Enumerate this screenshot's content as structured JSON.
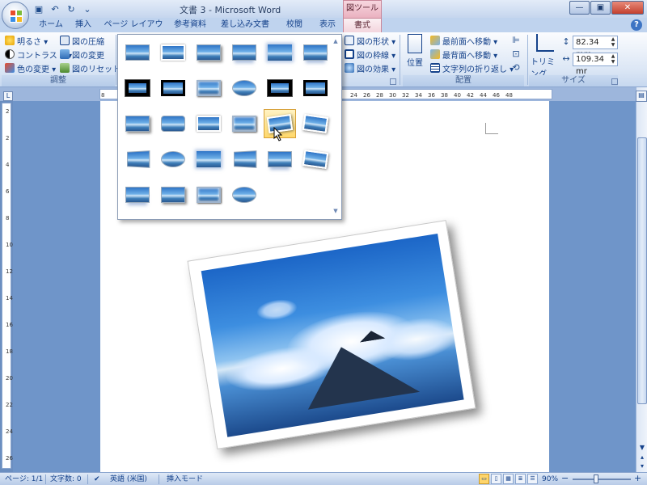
{
  "titlebar": {
    "title": "文書 3 - Microsoft Word",
    "tool_tab_title": "図ツール",
    "window_controls": {
      "minimize": "—",
      "maximize": "▣",
      "close": "✕"
    }
  },
  "qat": {
    "save_icon": "save-icon",
    "undo": "↶",
    "redo": "↻"
  },
  "tabs": [
    {
      "label": "ホーム"
    },
    {
      "label": "挿入"
    },
    {
      "label": "ページ レイアウト"
    },
    {
      "label": "参考資料"
    },
    {
      "label": "差し込み文書"
    },
    {
      "label": "校閲"
    },
    {
      "label": "表示"
    },
    {
      "label": "書式"
    }
  ],
  "ribbon": {
    "adjust": {
      "brightness": "明るさ ▾",
      "contrast": "コントラスト ▾",
      "recolor": "色の変更 ▾",
      "compress": "図の圧縮",
      "change_picture": "図の変更",
      "reset_picture": "図のリセット",
      "group_label": "調整"
    },
    "styles": {
      "shape": "図の形状 ▾",
      "border": "図の枠線 ▾",
      "effects": "図の効果 ▾"
    },
    "arrange": {
      "position": "位置",
      "bring_front": "最前面へ移動 ▾",
      "send_back": "最背面へ移動 ▾",
      "text_wrap": "文字列の折り返し ▾",
      "group_label": "配置"
    },
    "size": {
      "crop": "トリミング",
      "height": "82.34 mm",
      "width": "109.34 mr",
      "group_label": "サイズ"
    }
  },
  "ruler": {
    "top_numbers": [
      "8",
      "24",
      "26",
      "28",
      "30",
      "32",
      "34",
      "36",
      "38",
      "40",
      "42",
      "44",
      "46",
      "48"
    ],
    "left_numbers": [
      "2",
      "2",
      "4",
      "6",
      "8",
      "10",
      "12",
      "14",
      "16",
      "18",
      "20",
      "22",
      "24",
      "26"
    ]
  },
  "status": {
    "page": "ページ: 1/1",
    "words": "文字数: 0",
    "language": "英語 (米国)",
    "mode": "挿入モード",
    "zoom": "90%",
    "zoom_out": "−",
    "zoom_in": "+"
  },
  "gallery": {
    "items": [
      {
        "style": "s-plain",
        "name": "simple-frame-style"
      },
      {
        "style": "s-white",
        "name": "white-frame-style"
      },
      {
        "style": "s-shadow",
        "name": "drop-shadow-style"
      },
      {
        "style": "s-reflect",
        "name": "reflected-style"
      },
      {
        "style": "s-soft",
        "name": "soft-edge-style"
      },
      {
        "style": "s-reflect",
        "name": "reflected-rounded-style"
      },
      {
        "style": "s-thick",
        "name": "thick-black-frame-style"
      },
      {
        "style": "s-black",
        "name": "black-frame-style"
      },
      {
        "style": "s-bevel",
        "name": "beveled-style"
      },
      {
        "style": "s-oval",
        "name": "oval-style"
      },
      {
        "style": "s-thick",
        "name": "metal-frame-style"
      },
      {
        "style": "s-black",
        "name": "double-frame-style"
      },
      {
        "style": "s-shadow",
        "name": "center-shadow-style"
      },
      {
        "style": "s-round",
        "name": "rounded-diagonal-style"
      },
      {
        "style": "s-white",
        "name": "snip-corner-style"
      },
      {
        "style": "s-bevel",
        "name": "simple-white-style"
      },
      {
        "style": "s-tilt-l",
        "name": "rotated-white-style"
      },
      {
        "style": "s-tilt-r",
        "name": "perspective-shadow-style"
      },
      {
        "style": "s-persp",
        "name": "relaxed-perspective-style"
      },
      {
        "style": "s-oval",
        "name": "soft-oval-style"
      },
      {
        "style": "s-soft",
        "name": "glow-style"
      },
      {
        "style": "s-persp",
        "name": "bevel-perspective-style"
      },
      {
        "style": "s-reflect",
        "name": "reflected-bevel-style"
      },
      {
        "style": "s-tilt-r",
        "name": "tilted-frame-style"
      },
      {
        "style": "s-reflect",
        "name": "black-reflected-style"
      },
      {
        "style": "s-shadow",
        "name": "moderate-frame-style"
      },
      {
        "style": "s-bevel",
        "name": "metal-rounded-style"
      },
      {
        "style": "s-oval",
        "name": "metal-oval-style"
      }
    ],
    "hover_index": 16
  }
}
